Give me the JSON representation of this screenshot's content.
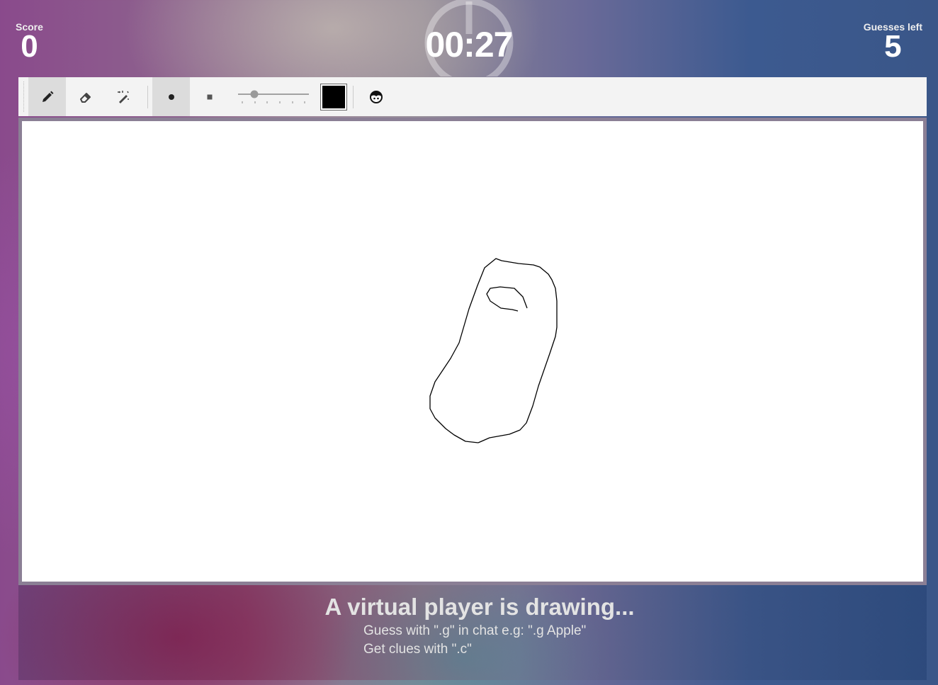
{
  "hud": {
    "score_label": "Score",
    "score_value": "0",
    "timer": "00:27",
    "guesses_label": "Guesses left",
    "guesses_value": "5"
  },
  "toolbar": {
    "tools": [
      {
        "name": "pencil-icon",
        "active": true
      },
      {
        "name": "eraser-icon",
        "active": false
      },
      {
        "name": "magic-wand-icon",
        "active": false
      }
    ],
    "brush_shapes": [
      {
        "name": "round-brush-icon",
        "active": true
      },
      {
        "name": "square-brush-icon",
        "active": false
      }
    ],
    "brush_size_slider": {
      "value_fraction": 0.2
    },
    "current_color": "#000000",
    "extra_icon": "smiley-face-icon"
  },
  "status": {
    "title": "A virtual player is drawing...",
    "hint_guess": "Guess with \".g\" in chat e.g: \".g Apple\"",
    "hint_clues": "Get clues with \".c\""
  },
  "colors": {
    "toolbar_bg": "#f3f3f3",
    "active_tool_bg": "#dcdcdc",
    "canvas_bg": "#ffffff",
    "stroke": "#000000"
  }
}
